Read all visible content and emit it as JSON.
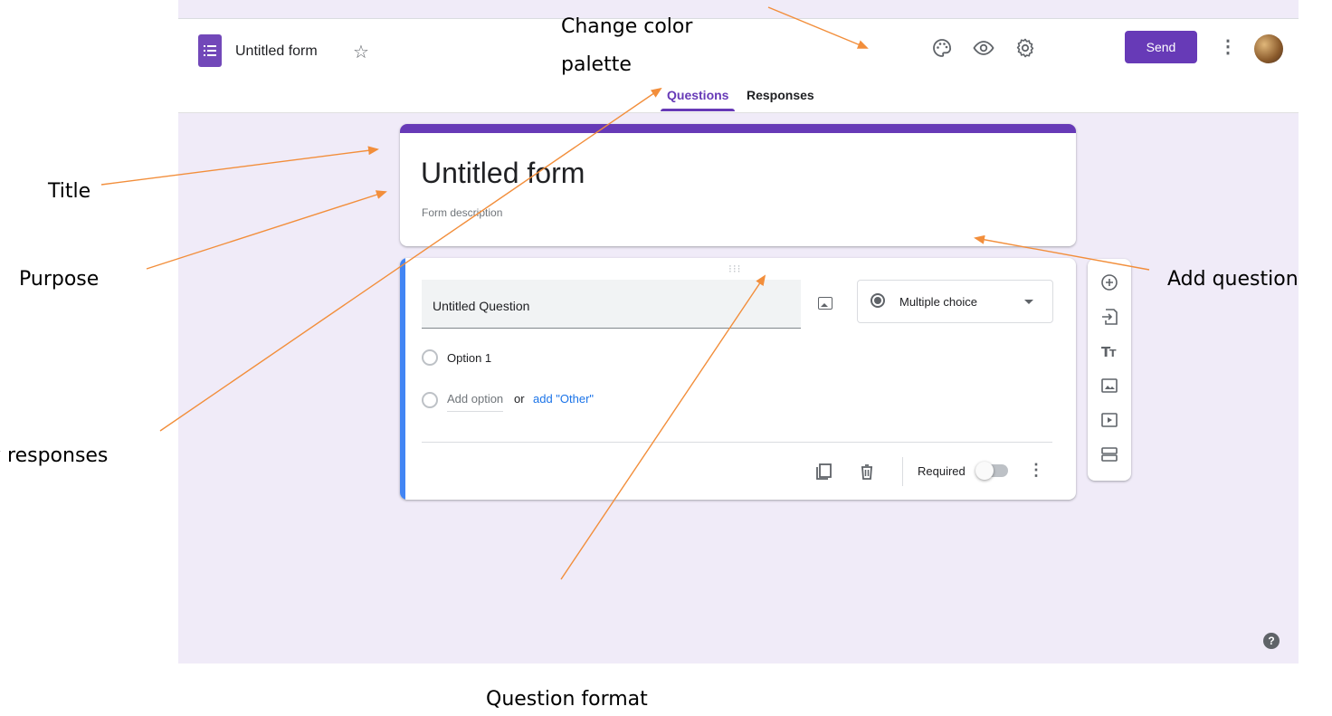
{
  "app": {
    "form_name": "Untitled form",
    "star_icon": "star-outline-icon",
    "toolbar_icons": [
      "palette-icon",
      "eye-icon",
      "gear-icon"
    ],
    "send_label": "Send",
    "menu_icon": "more-vert-icon",
    "tabs": [
      {
        "label": "Questions",
        "active": true
      },
      {
        "label": "Responses",
        "active": false
      }
    ]
  },
  "form": {
    "title": "Untitled form",
    "description_placeholder": "Form description"
  },
  "question": {
    "title": "Untitled Question",
    "type_label": "Multiple choice",
    "options": [
      "Option 1"
    ],
    "add_option": "Add option",
    "or": "or",
    "add_other": "add \"Other\"",
    "required_label": "Required",
    "required": false
  },
  "side_toolbar": [
    "add-circle-icon",
    "import-questions-icon",
    "title-text-icon",
    "image-icon",
    "video-icon",
    "section-icon"
  ],
  "annotations": {
    "color_palette": [
      "Change color",
      "palette"
    ],
    "title": "Title",
    "purpose": "Purpose",
    "responses": "y responses",
    "add_question": "Add question",
    "question_format": "Question format"
  },
  "colors": {
    "accent": "#673ab7",
    "background": "#f0ebf8",
    "question_highlight": "#4285f4",
    "annotation_arrow": "#f28e3b"
  }
}
